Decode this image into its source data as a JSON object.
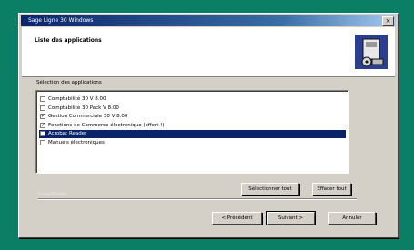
{
  "window": {
    "title": "Sage Ligne 30 Windows",
    "close_glyph": "×"
  },
  "header": {
    "title": "Liste des applications",
    "subtitle": "",
    "icon": "wizard-install-icon"
  },
  "group": {
    "label": "Sélection des applications"
  },
  "applications": [
    {
      "label": "Comptabilité 30 V 8.00",
      "checked": false,
      "selected": false
    },
    {
      "label": "Comptabilité 30 Pack V 8.00",
      "checked": false,
      "selected": false
    },
    {
      "label": "Gestion Commerciale 30 V 8.00",
      "checked": true,
      "selected": false
    },
    {
      "label": "Fonctions de Commerce électronique (offert !)",
      "checked": true,
      "selected": false
    },
    {
      "label": "Acrobat Reader",
      "checked": false,
      "selected": true
    },
    {
      "label": "Manuels électroniques",
      "checked": false,
      "selected": false
    }
  ],
  "buttons": {
    "select_all": "Sélectionner tout",
    "clear_all": "Effacer tout",
    "previous": "< Précédent",
    "next": "Suivant >",
    "cancel": "Annuler"
  },
  "footer": {
    "label": "InstallShield"
  },
  "colors": {
    "desktop": "#0a7f66",
    "selection": "#0a246a",
    "face": "#d4d0c8"
  }
}
